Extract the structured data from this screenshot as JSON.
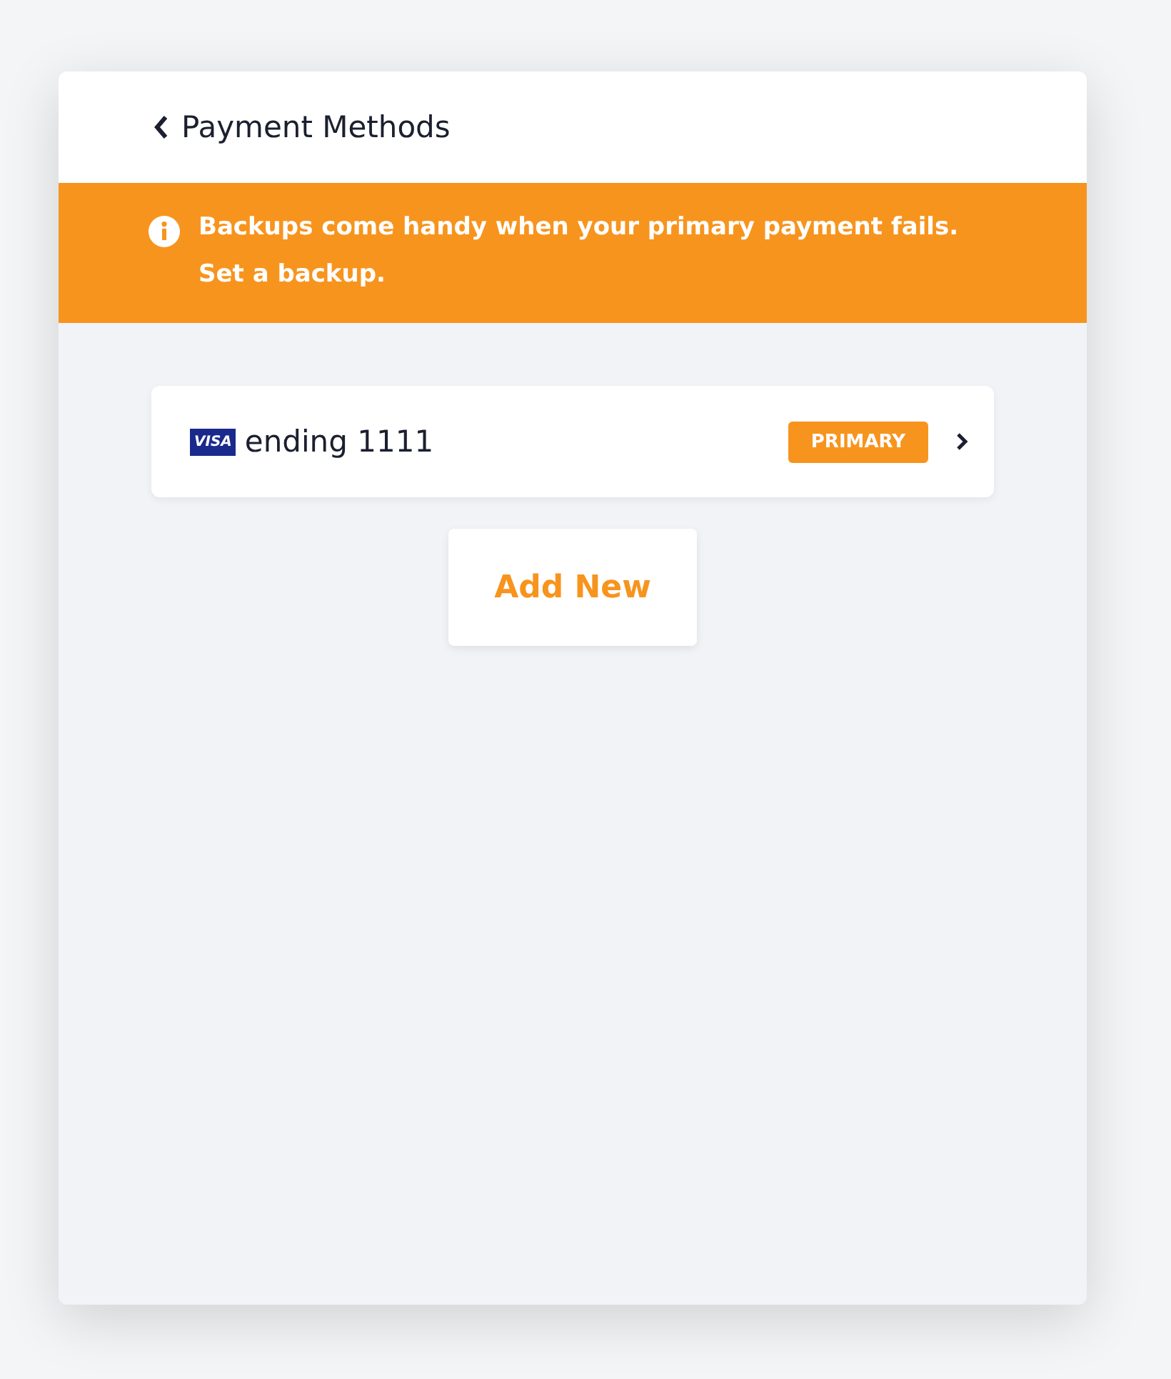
{
  "header": {
    "title": "Payment Methods"
  },
  "banner": {
    "lines": [
      "Backups come handy when your primary payment fails.",
      "Set a backup."
    ]
  },
  "payment_methods": [
    {
      "brand": "VISA",
      "label": "ending 1111",
      "badge": "PRIMARY"
    }
  ],
  "add_button": "Add New"
}
